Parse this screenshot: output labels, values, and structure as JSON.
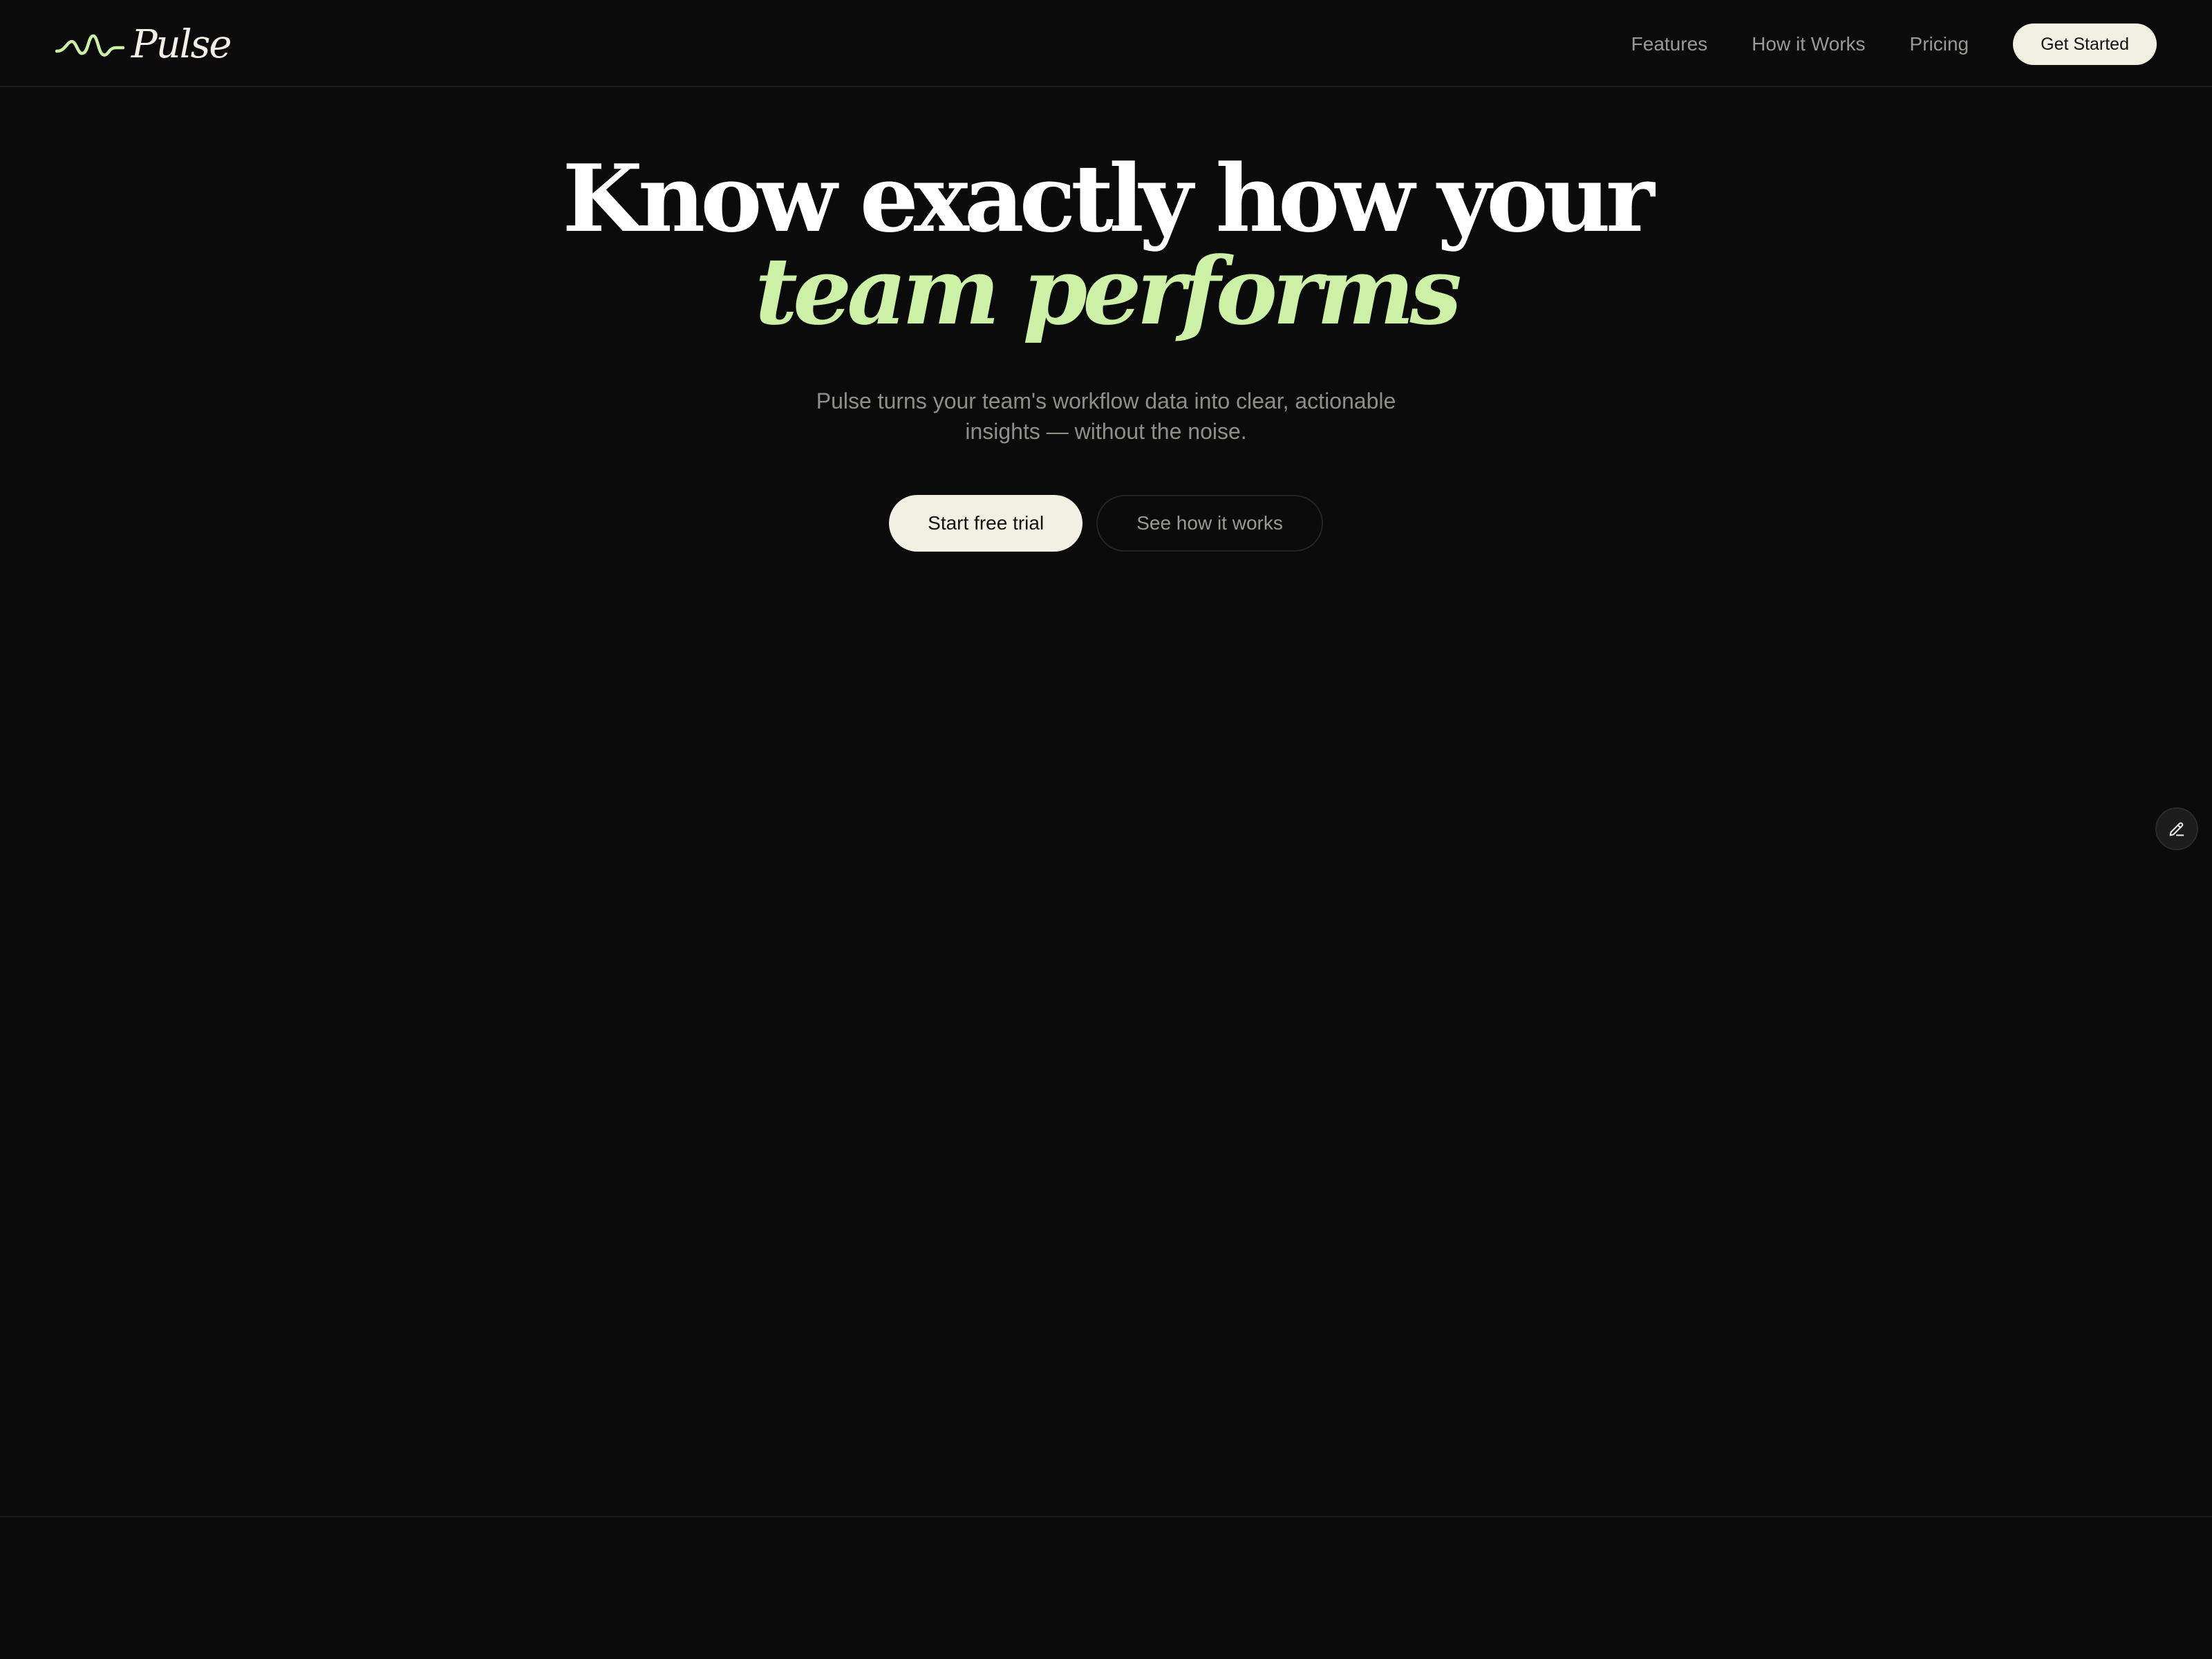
{
  "brand": {
    "name": "Pulse",
    "accent_color": "#cbf0a6",
    "mark_icon": "waveform-icon"
  },
  "nav": {
    "links": [
      "Features",
      "How it Works",
      "Pricing"
    ],
    "cta_label": "Get Started"
  },
  "hero": {
    "title_line1": "Know exactly how your",
    "title_line2": "team performs",
    "subtitle": "Pulse turns your team's workflow data into clear, actionable insights — without the noise.",
    "primary_cta": "Start free trial",
    "secondary_cta": "See how it works"
  },
  "floating_action": {
    "icon": "pencil-icon"
  },
  "colors": {
    "background": "#0b0b0b",
    "button_light": "#f2efe3",
    "muted_text": "#9a9a95"
  }
}
